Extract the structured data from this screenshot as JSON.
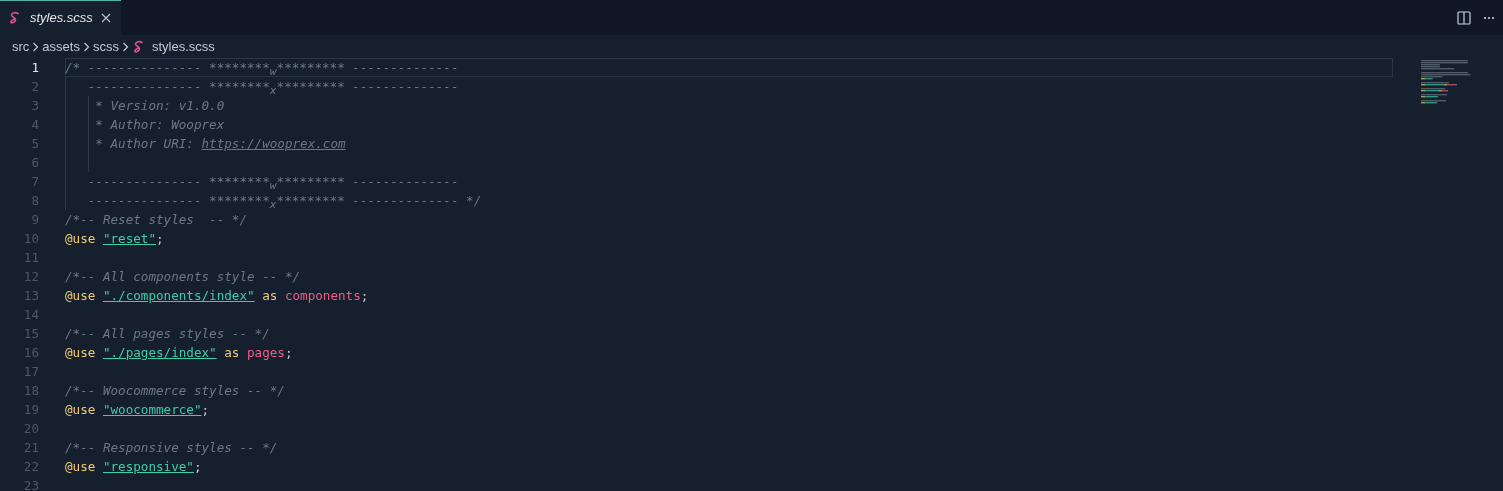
{
  "tabs": [
    {
      "label": "styles.scss",
      "selected": true
    }
  ],
  "breadcrumbs": [
    "src",
    "assets",
    "scss",
    "styles.scss"
  ],
  "editor": {
    "lines": [
      {
        "number": "1",
        "selected": true,
        "tokens": [
          {
            "kind": "comment",
            "text": "/* --------------- ********"
          },
          {
            "kind": "lowered",
            "text": "w"
          },
          {
            "kind": "comment",
            "text": "********* --------------"
          }
        ]
      },
      {
        "number": "2",
        "selected": false,
        "tokens": [
          {
            "kind": "comment",
            "text": "   --------------- ********"
          },
          {
            "kind": "lowered",
            "text": "x"
          },
          {
            "kind": "comment",
            "text": "********* --------------"
          }
        ]
      },
      {
        "number": "3",
        "selected": false,
        "tokens": [
          {
            "kind": "comment",
            "text": "    * Version: v1.0.0"
          }
        ]
      },
      {
        "number": "4",
        "selected": false,
        "tokens": [
          {
            "kind": "comment",
            "text": "    * Author: Wooprex"
          }
        ]
      },
      {
        "number": "5",
        "selected": false,
        "tokens": [
          {
            "kind": "comment",
            "text": "    * Author URI: "
          },
          {
            "kind": "link",
            "text": "https://wooprex.com"
          }
        ]
      },
      {
        "number": "6",
        "selected": false
      },
      {
        "number": "7",
        "selected": false,
        "tokens": [
          {
            "kind": "comment",
            "text": "   --------------- ********"
          },
          {
            "kind": "lowered",
            "text": "w"
          },
          {
            "kind": "comment",
            "text": "********* --------------"
          }
        ]
      },
      {
        "number": "8",
        "selected": false,
        "tokens": [
          {
            "kind": "comment",
            "text": "   --------------- ********"
          },
          {
            "kind": "lowered",
            "text": "x"
          },
          {
            "kind": "comment",
            "text": "********* -------------- */"
          }
        ]
      },
      {
        "number": "9",
        "selected": false,
        "tokens": [
          {
            "kind": "comment",
            "text": "/*-- Reset styles  -- */"
          }
        ]
      },
      {
        "number": "10",
        "selected": false,
        "tokens": [
          {
            "kind": "keyword",
            "text": "@use "
          },
          {
            "kind": "string",
            "text": "\"reset\""
          },
          {
            "kind": "plain",
            "text": ";"
          }
        ]
      },
      {
        "number": "11",
        "selected": false
      },
      {
        "number": "12",
        "selected": false,
        "tokens": [
          {
            "kind": "comment",
            "text": "/*-- All components style -- */"
          }
        ]
      },
      {
        "number": "13",
        "selected": false,
        "tokens": [
          {
            "kind": "keyword",
            "text": "@use "
          },
          {
            "kind": "string",
            "text": "\"./components/index\""
          },
          {
            "kind": "keyword",
            "text": " as "
          },
          {
            "kind": "name",
            "text": "components"
          },
          {
            "kind": "plain",
            "text": ";"
          }
        ]
      },
      {
        "number": "14",
        "selected": false
      },
      {
        "number": "15",
        "selected": false,
        "tokens": [
          {
            "kind": "comment",
            "text": "/*-- All pages styles -- */"
          }
        ]
      },
      {
        "number": "16",
        "selected": false,
        "tokens": [
          {
            "kind": "keyword",
            "text": "@use "
          },
          {
            "kind": "string",
            "text": "\"./pages/index\""
          },
          {
            "kind": "keyword",
            "text": " as "
          },
          {
            "kind": "name",
            "text": "pages"
          },
          {
            "kind": "plain",
            "text": ";"
          }
        ]
      },
      {
        "number": "17",
        "selected": false
      },
      {
        "number": "18",
        "selected": false,
        "tokens": [
          {
            "kind": "comment",
            "text": "/*-- Woocommerce styles -- */"
          }
        ]
      },
      {
        "number": "19",
        "selected": false,
        "tokens": [
          {
            "kind": "keyword",
            "text": "@use "
          },
          {
            "kind": "string",
            "text": "\"woocommerce\""
          },
          {
            "kind": "plain",
            "text": ";"
          }
        ]
      },
      {
        "number": "20",
        "selected": false
      },
      {
        "number": "21",
        "selected": false,
        "tokens": [
          {
            "kind": "comment",
            "text": "/*-- Responsive styles -- */"
          }
        ]
      },
      {
        "number": "22",
        "selected": false,
        "tokens": [
          {
            "kind": "keyword",
            "text": "@use "
          },
          {
            "kind": "string",
            "text": "\"responsive\""
          },
          {
            "kind": "plain",
            "text": ";"
          }
        ]
      },
      {
        "number": "23",
        "selected": false
      }
    ]
  }
}
